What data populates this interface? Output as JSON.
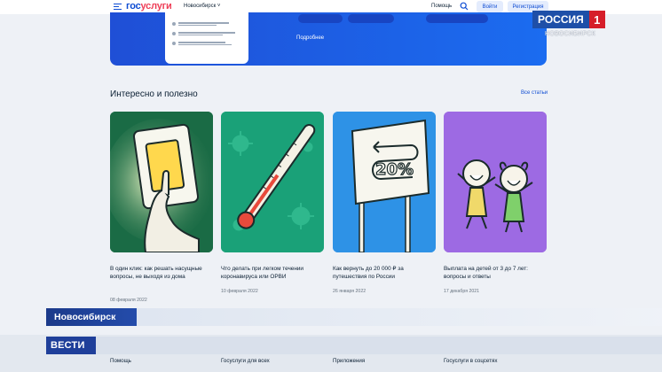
{
  "header": {
    "logo_part1": "гос",
    "logo_part2": "услуги",
    "city": "Новосибирск ˅",
    "help": "Помощь",
    "login": "Войти",
    "register": "Регистрация"
  },
  "banner": {
    "more_link": "Подробнее"
  },
  "section": {
    "title": "Интересно и полезно",
    "all_link": "Все статьи"
  },
  "cards": [
    {
      "title": "В один клик: как решать насущные вопросы, не выходя из дома",
      "date": "08 февраля 2022",
      "image": "light-switch-hand"
    },
    {
      "title": "Что делать при легком течении коронавируса или ОРВИ",
      "date": "10 февраля 2022",
      "image": "thermometer-virus"
    },
    {
      "title": "Как вернуть до 20 000 ₽ за путешествия по России",
      "date": "26 января 2022",
      "image": "road-sign-20-percent"
    },
    {
      "title": "Выплата на детей от 3 до 7 лет: вопросы и ответы",
      "date": "17 декабря 2021",
      "image": "happy-kids"
    }
  ],
  "footer": {
    "col1": "Помощь",
    "col2": "Госуслуги для всех",
    "col3": "Приложения",
    "col4": "Госуслуги в соцсетях"
  },
  "broadcast": {
    "channel": "РОССИЯ",
    "channel_number": "1",
    "channel_sub": "НОВОСИБИРСК",
    "city_plate": "Новосибирск",
    "program": "ВЕСТИ"
  },
  "colors": {
    "brand_blue": "#0d4cd3",
    "brand_red": "#ee3f58",
    "card1": "#1a6b45",
    "card2": "#1aa178",
    "card3": "#2e92e6",
    "card4": "#9d6ae3"
  }
}
